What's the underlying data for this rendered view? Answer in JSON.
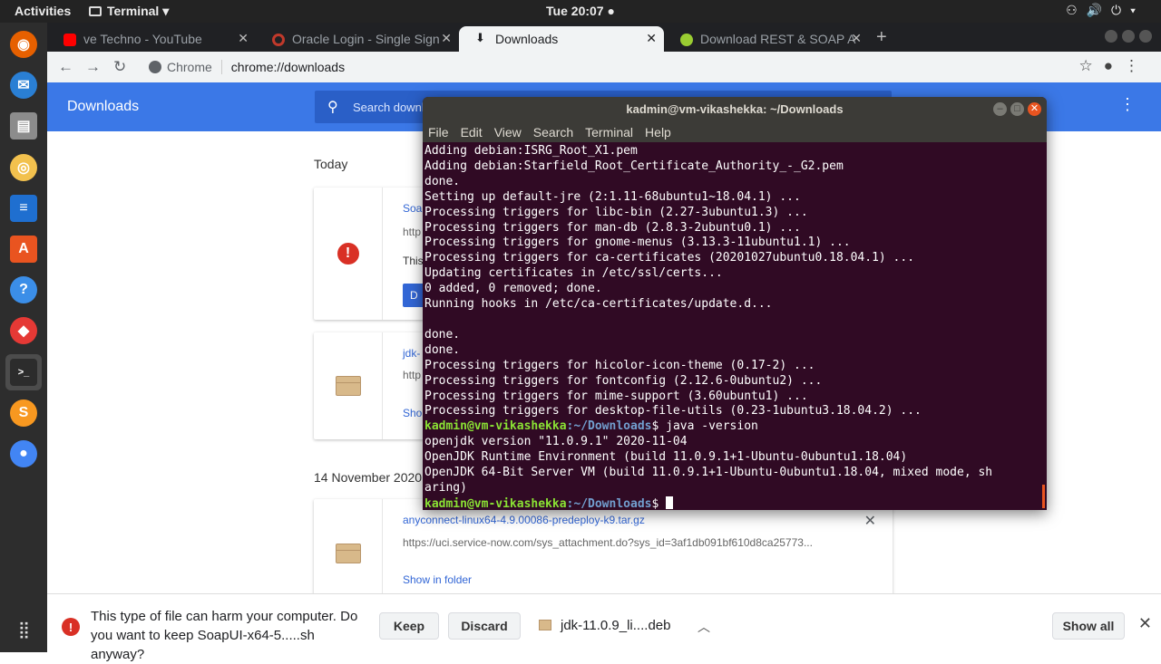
{
  "topbar": {
    "activities": "Activities",
    "app": "Terminal",
    "clock": "Tue 20:07"
  },
  "dock": {
    "items": [
      {
        "name": "firefox-icon",
        "color": "#e66000",
        "glyph": "◉"
      },
      {
        "name": "thunderbird-icon",
        "color": "#2a7fd4",
        "glyph": "✉"
      },
      {
        "name": "files-icon",
        "color": "#8c8c8c",
        "glyph": "▤"
      },
      {
        "name": "rhythmbox-icon",
        "color": "#f2c14e",
        "glyph": "◎"
      },
      {
        "name": "writer-icon",
        "color": "#1f6fd0",
        "glyph": "≡"
      },
      {
        "name": "software-center-icon",
        "color": "#e95420",
        "glyph": "A"
      },
      {
        "name": "help-icon",
        "color": "#3b8ee8",
        "glyph": "?"
      },
      {
        "name": "anydesk-icon",
        "color": "#e53935",
        "glyph": "◆"
      },
      {
        "name": "terminal-icon",
        "color": "#2c2c2c",
        "glyph": ">_"
      },
      {
        "name": "sublime-icon",
        "color": "#f89820",
        "glyph": "S"
      },
      {
        "name": "chrome-icon",
        "color": "#4285f4",
        "glyph": "●"
      }
    ]
  },
  "tabs": [
    {
      "label": "ve Techno - YouTube",
      "fav": "#ff0000"
    },
    {
      "label": "Oracle Login - Single Sign",
      "fav": "#c0392b"
    },
    {
      "label": "Downloads",
      "fav": "#202124"
    },
    {
      "label": "Download REST & SOAP A",
      "fav": "#9acd32"
    }
  ],
  "omnibox": {
    "chip": "Chrome",
    "url": "chrome://downloads"
  },
  "downloads_header": {
    "title": "Downloads",
    "search_placeholder": "Search downloads"
  },
  "sections": [
    {
      "date": "Today"
    },
    {
      "date": "14 November 2020"
    }
  ],
  "cards": [
    {
      "name": "Soap",
      "url": "http",
      "note": "This",
      "action": "D"
    },
    {
      "name": "jdk-",
      "url": "http",
      "action": "Sho"
    },
    {
      "name": "anyconnect-linux64-4.9.00086-predeploy-k9.tar.gz",
      "url": "https://uci.service-now.com/sys_attachment.do?sys_id=3af1db091bf610d8ca25773...",
      "action": "Show in folder"
    }
  ],
  "shelf": {
    "warning": "This type of file can harm your computer. Do you want to keep SoapUI-x64-5.....sh anyway?",
    "keep": "Keep",
    "discard": "Discard",
    "item": "jdk-11.0.9_li....deb",
    "show_all": "Show all"
  },
  "terminal": {
    "title": "kadmin@vm-vikashekka: ~/Downloads",
    "menu": [
      "File",
      "Edit",
      "View",
      "Search",
      "Terminal",
      "Help"
    ],
    "lines": [
      "Adding debian:ISRG_Root_X1.pem",
      "Adding debian:Starfield_Root_Certificate_Authority_-_G2.pem",
      "done.",
      "Setting up default-jre (2:1.11-68ubuntu1~18.04.1) ...",
      "Processing triggers for libc-bin (2.27-3ubuntu1.3) ...",
      "Processing triggers for man-db (2.8.3-2ubuntu0.1) ...",
      "Processing triggers for gnome-menus (3.13.3-11ubuntu1.1) ...",
      "Processing triggers for ca-certificates (20201027ubuntu0.18.04.1) ...",
      "Updating certificates in /etc/ssl/certs...",
      "0 added, 0 removed; done.",
      "Running hooks in /etc/ca-certificates/update.d...",
      "",
      "done.",
      "done.",
      "Processing triggers for hicolor-icon-theme (0.17-2) ...",
      "Processing triggers for fontconfig (2.12.6-0ubuntu2) ...",
      "Processing triggers for mime-support (3.60ubuntu1) ...",
      "Processing triggers for desktop-file-utils (0.23-1ubuntu3.18.04.2) ..."
    ],
    "prompt_user": "kadmin@vm-vikashekka",
    "prompt_path": ":~/Downloads",
    "command": "$ java -version",
    "output": [
      "openjdk version \"11.0.9.1\" 2020-11-04",
      "OpenJDK Runtime Environment (build 11.0.9.1+1-Ubuntu-0ubuntu1.18.04)",
      "OpenJDK 64-Bit Server VM (build 11.0.9.1+1-Ubuntu-0ubuntu1.18.04, mixed mode, sh",
      "aring)"
    ],
    "final_prompt": "$ "
  }
}
